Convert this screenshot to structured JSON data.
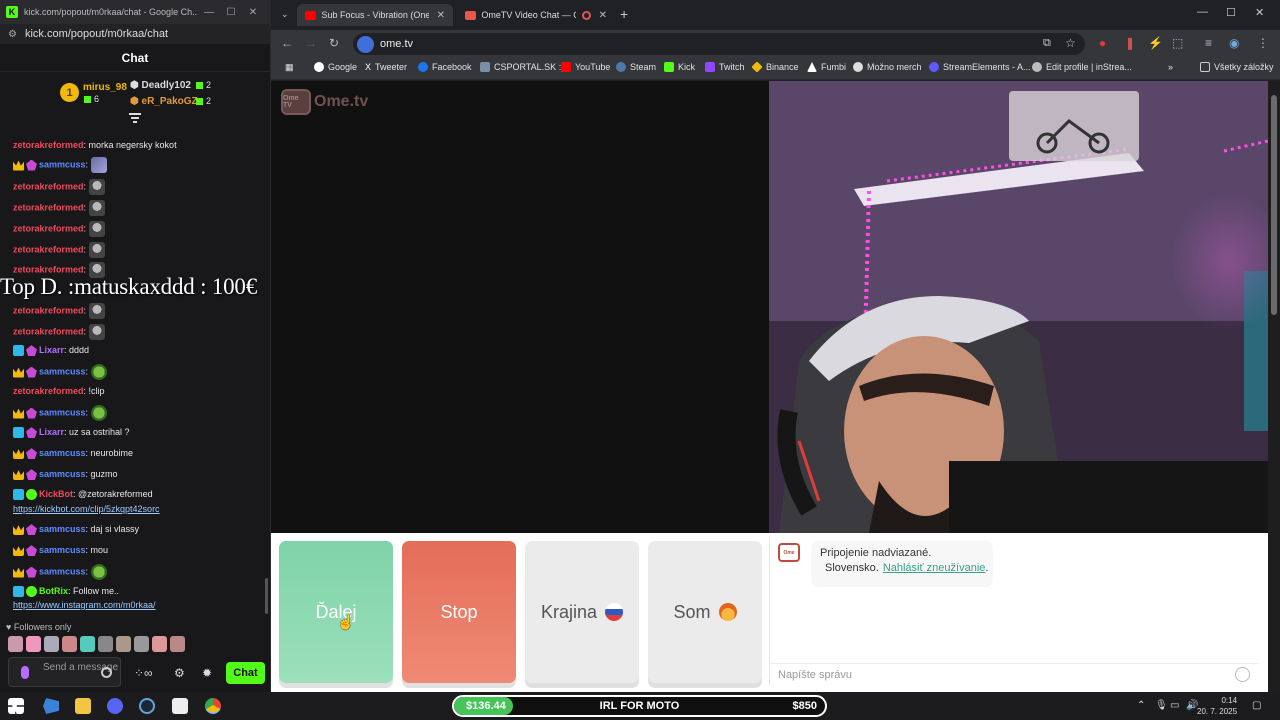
{
  "chat_window": {
    "title": "kick.com/popout/m0rkaa/chat - Google Ch...",
    "url": "kick.com/popout/m0rkaa/chat",
    "header": "Chat",
    "leaderboard": {
      "first_rank": "1",
      "first_name": "mirus_98",
      "first_count": "6",
      "second_name": "Deadly102",
      "second_count": "2",
      "third_name": "eR_PakoGZ",
      "third_count": "2"
    },
    "messages": [
      {
        "user": "zetorakreformed",
        "text": ": morka negersky kokot"
      },
      {
        "user": "sammcuss",
        "text": ":"
      },
      {
        "user": "zetorakreformed",
        "text": ":"
      },
      {
        "user": "zetorakreformed",
        "text": ":"
      },
      {
        "user": "zetorakreformed",
        "text": ":"
      },
      {
        "user": "zetorakreformed",
        "text": ":"
      },
      {
        "user": "zetorakreformed",
        "text": ":"
      },
      {
        "user": "zetorakreformed",
        "text": ":"
      },
      {
        "user": "zetorakreformed",
        "text": ":"
      },
      {
        "user": "Lixarr",
        "text": ": dddd"
      },
      {
        "user": "sammcuss",
        "text": ":"
      },
      {
        "user": "zetorakreformed",
        "text": ": !clip"
      },
      {
        "user": "sammcuss",
        "text": ":"
      },
      {
        "user": "Lixarr",
        "text": ": uz sa ostrihal ?"
      },
      {
        "user": "sammcuss",
        "text": ": neurobime"
      },
      {
        "user": "sammcuss",
        "text": ": guzmo"
      },
      {
        "user": "KickBot",
        "text": ": @zetorakreformed",
        "link": "https://kickbot.com/clip/5zkqpt42sorc"
      },
      {
        "user": "sammcuss",
        "text": ": daj si vlassy"
      },
      {
        "user": "sammcuss",
        "text": ": mou"
      },
      {
        "user": "sammcuss",
        "text": ":"
      },
      {
        "user": "BotRix",
        "text": ": Follow me..",
        "link": "https://www.instagram.com/m0rkaa/"
      }
    ],
    "overlay_text": "Top D. :matuskaxddd : 100€",
    "followers_only": "Followers only",
    "input_placeholder": "Send a message",
    "send_label": "Chat"
  },
  "browser": {
    "tabs": [
      {
        "label": "Sub Focus - Vibration (One Mo"
      },
      {
        "label": "OmeTV Video Chat — Ome"
      }
    ],
    "url": "ome.tv",
    "bookmarks": [
      "Google",
      "Tweeter",
      "Facebook",
      "CSPORTAL.SK :)",
      "YouTube",
      "Steam",
      "Kick",
      "Twitch",
      "Binance",
      "Fumbi",
      "Možno merch",
      "StreamElements - A...",
      "Edit profile | inStrea..."
    ],
    "all_bookmarks": "Všetky záložky",
    "colors": {
      "accent": "#53fc18",
      "next": "#8fdbb2",
      "stop": "#ea7c66"
    }
  },
  "ometv": {
    "logo_text": "Ome.tv",
    "logo_badge": "Ome TV",
    "buttons": {
      "next": "Ďalej",
      "stop": "Stop",
      "country": "Krajina",
      "gender": "Som"
    },
    "system_message": {
      "line1": "Pripojenie nadviazané.",
      "country": "Slovensko.",
      "report": "Nahlásiť zneužívanie",
      "dot": "."
    },
    "input_placeholder": "Napíšte správu"
  },
  "taskbar": {
    "goal_current": "$136.44",
    "goal_title": "IRL FOR MOTO",
    "goal_target": "$850",
    "goal_progress": 0.16,
    "time": "0:14",
    "date": "20. 7. 2025"
  }
}
